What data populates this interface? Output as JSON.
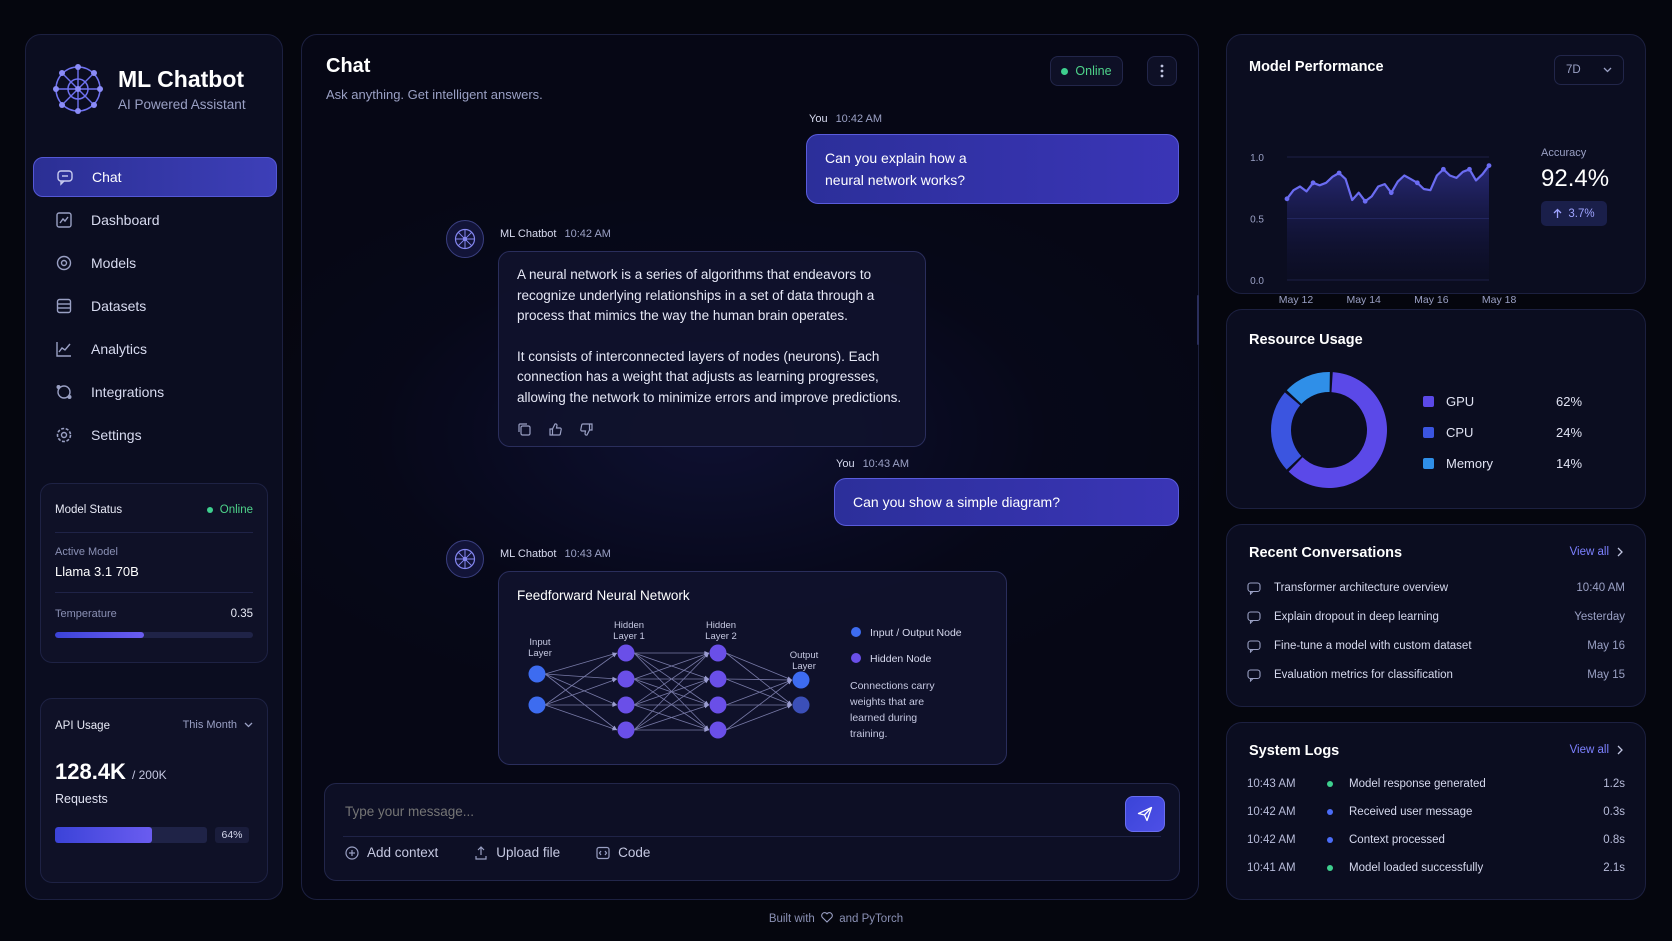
{
  "brand": {
    "title": "ML Chatbot",
    "subtitle": "AI Powered Assistant"
  },
  "nav": [
    {
      "label": "Chat",
      "icon": "chat-icon",
      "active": true
    },
    {
      "label": "Dashboard",
      "icon": "dashboard-icon"
    },
    {
      "label": "Models",
      "icon": "models-icon"
    },
    {
      "label": "Datasets",
      "icon": "datasets-icon"
    },
    {
      "label": "Analytics",
      "icon": "analytics-icon"
    },
    {
      "label": "Integrations",
      "icon": "integrations-icon"
    },
    {
      "label": "Settings",
      "icon": "gear-icon"
    }
  ],
  "model_status": {
    "title": "Model Status",
    "status": "Online",
    "active_model_label": "Active Model",
    "active_model": "Llama 3.1 70B",
    "temperature_label": "Temperature",
    "temperature": "0.35",
    "temperature_fraction": 0.45
  },
  "api_usage": {
    "title": "API Usage",
    "period": "This Month",
    "value": "128.4K",
    "limit": "/ 200K",
    "unit": "Requests",
    "percent_label": "64%",
    "fraction": 0.64
  },
  "chat": {
    "title": "Chat",
    "subtitle": "Ask anything. Get intelligent answers.",
    "status": "Online",
    "messages": [
      {
        "sender": "You",
        "time": "10:42 AM",
        "text_lines": [
          "Can you explain how a",
          "neural network works?"
        ]
      },
      {
        "sender": "ML Chatbot",
        "time": "10:42 AM",
        "para1": [
          "A neural network is a series of algorithms that endeavors to",
          "recognize underlying relationships in a set of data through a",
          "process that mimics the way the human brain operates."
        ],
        "para2": [
          "It consists of interconnected layers of nodes (neurons). Each",
          "connection has a weight that adjusts as learning progresses,",
          "allowing the network to minimize errors and improve predictions."
        ]
      },
      {
        "sender": "You",
        "time": "10:43 AM",
        "text": "Can you show a simple diagram?"
      },
      {
        "sender": "ML Chatbot",
        "time": "10:43 AM"
      }
    ],
    "diagram": {
      "title": "Feedforward Neural Network",
      "layer_labels": {
        "input": [
          "Input",
          "Layer"
        ],
        "hidden1": [
          "Hidden",
          "Layer 1"
        ],
        "hidden2": [
          "Hidden",
          "Layer 2"
        ],
        "output": [
          "Output",
          "Layer"
        ]
      },
      "legend": [
        "Input / Output Node",
        "Hidden Node"
      ],
      "note": [
        "Connections carry",
        "weights that are",
        "learned during",
        "training."
      ]
    },
    "composer": {
      "placeholder": "Type your message...",
      "tools": [
        "Add context",
        "Upload file",
        "Code"
      ]
    }
  },
  "performance": {
    "title": "Model Performance",
    "range": "7D",
    "metric_label": "Accuracy",
    "metric_value": "92.4%",
    "delta": "3.7%",
    "chart_data": {
      "type": "area",
      "x": [
        "May 12",
        "May 14",
        "May 16",
        "May 18"
      ],
      "yticks": [
        "1.0",
        "0.5",
        "0.0"
      ],
      "ylim": [
        0,
        1
      ],
      "values": [
        0.66,
        0.73,
        0.76,
        0.72,
        0.79,
        0.77,
        0.79,
        0.84,
        0.87,
        0.82,
        0.65,
        0.71,
        0.64,
        0.68,
        0.76,
        0.78,
        0.71,
        0.8,
        0.85,
        0.82,
        0.79,
        0.74,
        0.73,
        0.85,
        0.9,
        0.85,
        0.83,
        0.88,
        0.9,
        0.81,
        0.86,
        0.93
      ],
      "accent": "#6b6cf2"
    }
  },
  "resources": {
    "title": "Resource Usage",
    "chart_data": {
      "type": "pie",
      "items": [
        {
          "name": "GPU",
          "value": 62,
          "label": "62%",
          "color": "#5b49e8"
        },
        {
          "name": "CPU",
          "value": 24,
          "label": "24%",
          "color": "#3b55e0"
        },
        {
          "name": "Memory",
          "value": 14,
          "label": "14%",
          "color": "#2f8fe8"
        }
      ]
    }
  },
  "recent": {
    "title": "Recent Conversations",
    "view_all": "View all",
    "items": [
      {
        "title": "Transformer architecture overview",
        "time": "10:40 AM"
      },
      {
        "title": "Explain dropout in deep learning",
        "time": "Yesterday"
      },
      {
        "title": "Fine-tune a model with custom dataset",
        "time": "May 16"
      },
      {
        "title": "Evaluation metrics for classification",
        "time": "May 15"
      }
    ]
  },
  "logs": {
    "title": "System Logs",
    "view_all": "View all",
    "items": [
      {
        "time": "10:43 AM",
        "message": "Model response generated",
        "duration": "1.2s",
        "color": "#3ecf8e"
      },
      {
        "time": "10:42 AM",
        "message": "Received user message",
        "duration": "0.3s",
        "color": "#4a6cf7"
      },
      {
        "time": "10:42 AM",
        "message": "Context processed",
        "duration": "0.8s",
        "color": "#4a6cf7"
      },
      {
        "time": "10:41 AM",
        "message": "Model loaded successfully",
        "duration": "2.1s",
        "color": "#3ecf8e"
      }
    ]
  },
  "footer": {
    "before": "Built with",
    "after": "and PyTorch"
  }
}
